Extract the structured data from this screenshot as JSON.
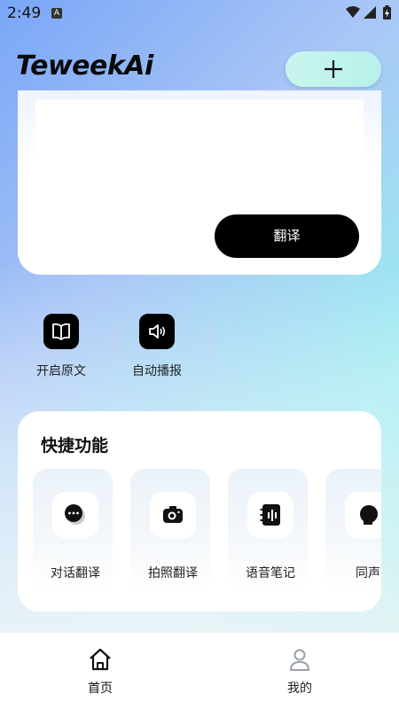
{
  "status_bar": {
    "time": "2:49",
    "notification_letter": "A"
  },
  "header": {
    "logo_text": "TeweekAi"
  },
  "translate": {
    "button_label": "翻译"
  },
  "toggles": [
    {
      "label": "开启原文",
      "icon": "book-icon"
    },
    {
      "label": "自动播报",
      "icon": "speaker-icon"
    }
  ],
  "quick": {
    "title": "快捷功能",
    "items": [
      {
        "label": "对话翻译",
        "icon": "chat-bubble-icon"
      },
      {
        "label": "拍照翻译",
        "icon": "camera-icon"
      },
      {
        "label": "语音笔记",
        "icon": "voice-note-icon"
      },
      {
        "label": "同声",
        "icon": "simultaneous-icon"
      }
    ]
  },
  "nav": {
    "items": [
      {
        "label": "首页",
        "icon": "home-icon",
        "active": true
      },
      {
        "label": "我的",
        "icon": "profile-icon",
        "active": false
      }
    ]
  },
  "colors": {
    "accent": "#000000",
    "tile_bg": "#eaf2f9",
    "nav_inactive": "#9aa0a8"
  }
}
